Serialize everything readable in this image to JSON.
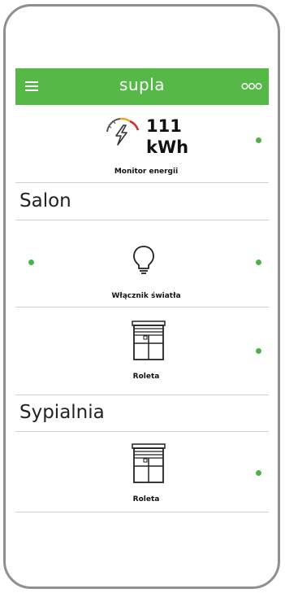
{
  "header": {
    "logo": "supla",
    "menu_icon": "hamburger-menu-icon",
    "more_icon": "three-circles-icon",
    "background_color": "#55b847"
  },
  "energy_monitor": {
    "value": "111",
    "unit": "kWh",
    "label": "Monitor energii",
    "icon": "gauge-lightning-icon"
  },
  "locations": [
    {
      "name": "Salon",
      "channels": [
        {
          "label": "Włącznik światła",
          "icon": "light-bulb-icon"
        },
        {
          "label": "Roleta",
          "icon": "roller-shutter-icon"
        }
      ]
    },
    {
      "name": "Sypialnia",
      "channels": [
        {
          "label": "Roleta",
          "icon": "roller-shutter-icon"
        }
      ]
    }
  ],
  "status_color": "#4cb447"
}
